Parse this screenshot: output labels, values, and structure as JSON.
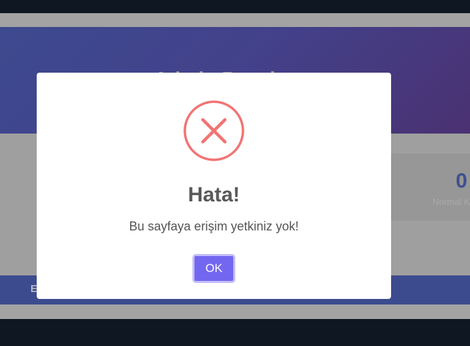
{
  "header": {
    "title": "Admin Panel"
  },
  "stats": {
    "value": "0",
    "label": "Normal K"
  },
  "nav": {
    "first_item": "E"
  },
  "dialog": {
    "icon": "error-x-icon",
    "title": "Hata!",
    "message": "Bu sayfaya erişim yetkiniz yok!",
    "ok_label": "OK"
  },
  "colors": {
    "header_gradient_start": "#3d4a8f",
    "header_gradient_end": "#4a3172",
    "error_icon": "#f27474",
    "ok_button": "#7367f0",
    "nav_bar": "#3c4b8e"
  }
}
